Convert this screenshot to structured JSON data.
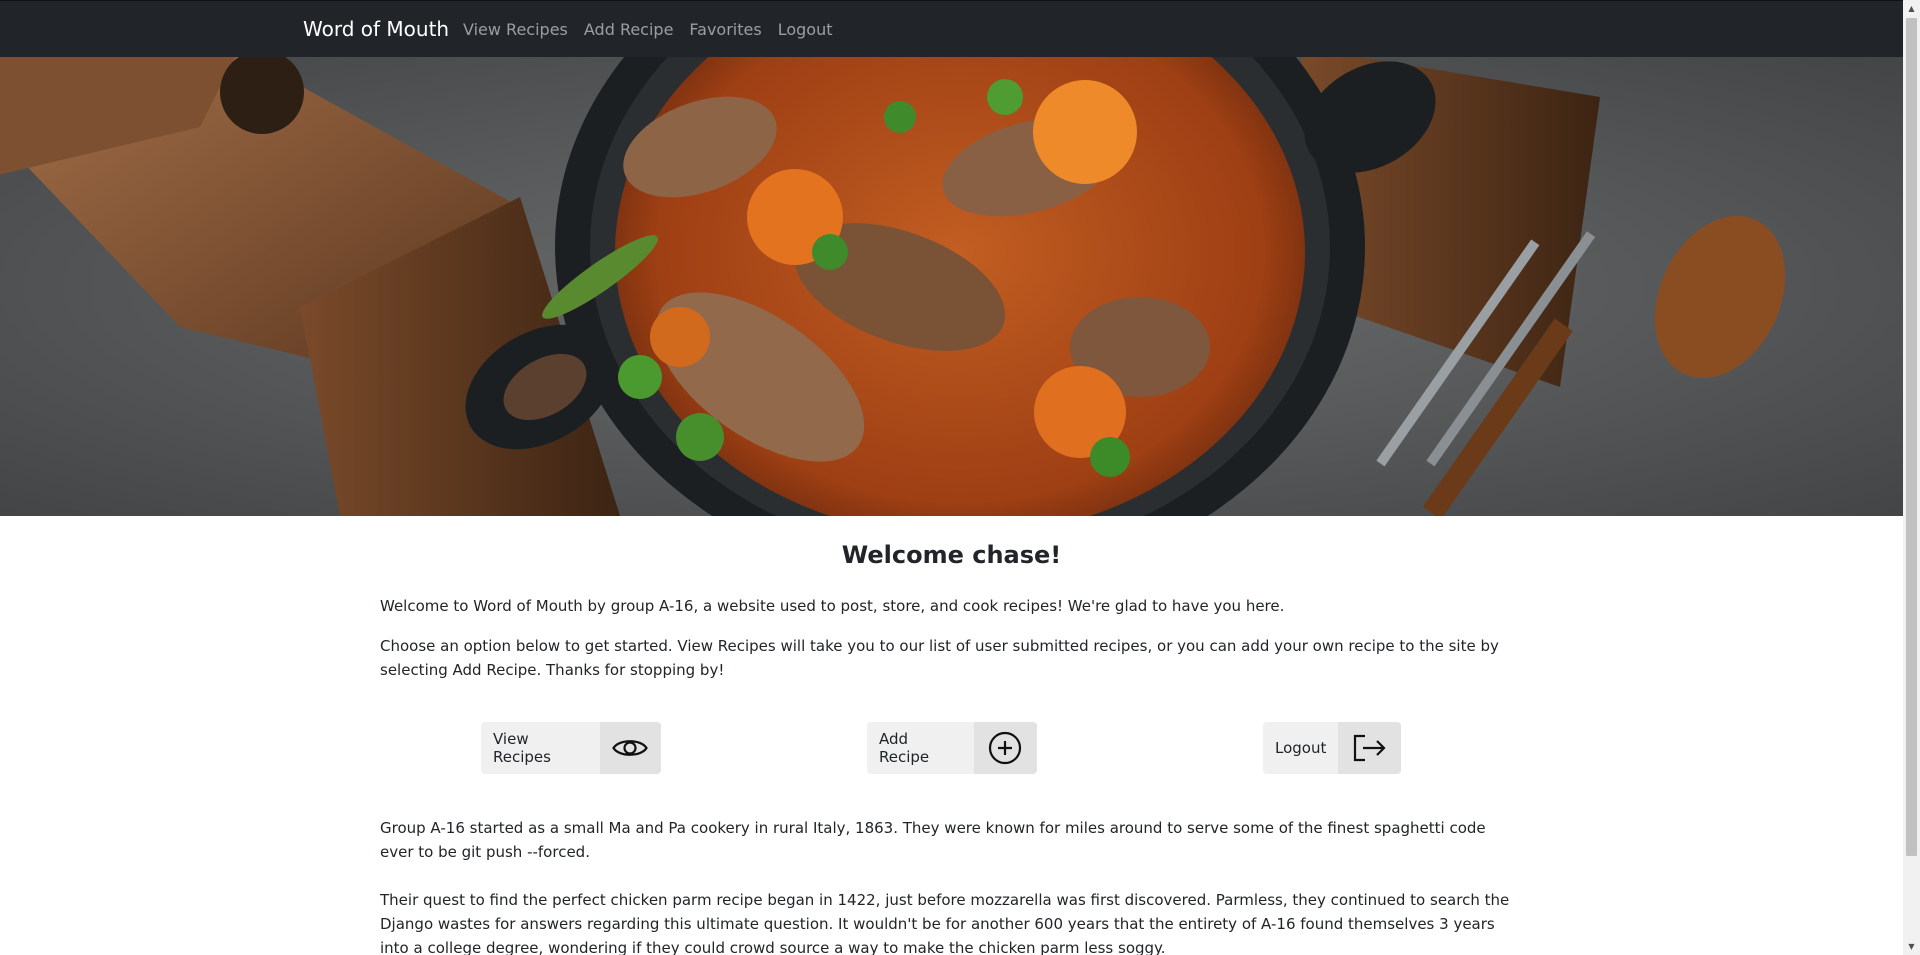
{
  "navbar": {
    "brand": "Word of Mouth",
    "links": [
      "View Recipes",
      "Add Recipe",
      "Favorites",
      "Logout"
    ]
  },
  "hero": {
    "alt": "stew-pot-hero-image"
  },
  "main": {
    "heading": "Welcome chase!",
    "paragraphs": [
      "Welcome to Word of Mouth by group A-16, a website used to post, store, and cook recipes! We're glad to have you here.",
      "Choose an option below to get started. View Recipes will take you to our list of user submitted recipes, or you can add your own recipe to the site by selecting Add Recipe. Thanks for stopping by!"
    ],
    "buttons": [
      {
        "label": "View Recipes",
        "icon": "eye-icon"
      },
      {
        "label": "Add Recipe",
        "icon": "plus-circle-icon"
      },
      {
        "label": "Logout",
        "icon": "logout-icon"
      }
    ],
    "about": [
      "Group A-16 started as a small Ma and Pa cookery in rural Italy, 1863. They were known for miles around to serve some of the finest spaghetti code ever to be git push --forced.",
      "Their quest to find the perfect chicken parm recipe began in 1422, just before mozzarella was first discovered. Parmless, they continued to search the Django wastes for answers regarding this ultimate question. It wouldn't be for another 600 years that the entirety of A-16 found themselves 3 years into a college degree, wondering if they could crowd source a way to make the chicken parm less soggy."
    ]
  },
  "colors": {
    "navbar": "#212529",
    "button_label_bg": "#f0f0f0",
    "button_icon_bg": "#e2e2e2"
  }
}
